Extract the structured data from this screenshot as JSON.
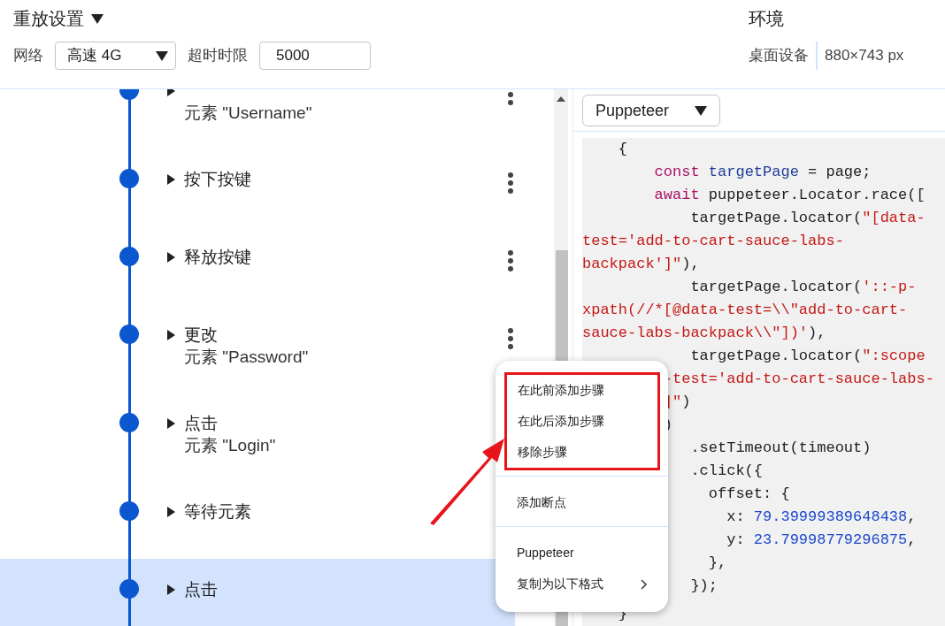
{
  "header": {
    "title": "重放设置",
    "network_label": "网络",
    "network_value": "高速 4G",
    "timeout_label": "超时时限",
    "timeout_value": "5000",
    "environment_title": "环境",
    "device": "桌面设备",
    "viewport": "880×743 px"
  },
  "steps": [
    {
      "subtitle": "元素 \"Username\"",
      "selected": false,
      "more_menu": true
    },
    {
      "title": "按下按键",
      "selected": false,
      "more_menu": true
    },
    {
      "title": "释放按键",
      "selected": false,
      "more_menu": true
    },
    {
      "title": "更改",
      "subtitle": "元素 \"Password\"",
      "selected": false,
      "more_menu": true
    },
    {
      "title": "点击",
      "subtitle": "元素 \"Login\"",
      "selected": false,
      "more_menu": false
    },
    {
      "title": "等待元素",
      "selected": false,
      "more_menu": false
    },
    {
      "title": "点击",
      "selected": true,
      "more_menu": false
    }
  ],
  "code_panel": {
    "format": "Puppeteer",
    "lines": [
      [
        {
          "kind": "plain",
          "text": "    {"
        }
      ],
      [
        {
          "kind": "keyword",
          "text": "        const "
        },
        {
          "kind": "def",
          "text": "targetPage"
        },
        {
          "kind": "plain",
          "text": " = page;"
        }
      ],
      [
        {
          "kind": "keyword",
          "text": "        await"
        },
        {
          "kind": "plain",
          "text": " puppeteer.Locator.race(["
        }
      ],
      [
        {
          "kind": "plain",
          "text": "            targetPage.locator("
        },
        {
          "kind": "string",
          "text": "\"[data-"
        }
      ],
      [
        {
          "kind": "string",
          "text": "test='add-to-cart-sauce-labs-"
        }
      ],
      [
        {
          "kind": "string",
          "text": "backpack']\""
        },
        {
          "kind": "plain",
          "text": "),"
        }
      ],
      [
        {
          "kind": "plain",
          "text": "            targetPage.locator("
        },
        {
          "kind": "string",
          "text": "'::-p-"
        }
      ],
      [
        {
          "kind": "string",
          "text": "xpath(//*[@data-test=\\\\\"add-to-cart-"
        }
      ],
      [
        {
          "kind": "string",
          "text": "sauce-labs-backpack\\\\\"])'"
        },
        {
          "kind": "plain",
          "text": "),"
        }
      ],
      [
        {
          "kind": "plain",
          "text": "            targetPage.locator("
        },
        {
          "kind": "string",
          "text": "\":scope"
        }
      ],
      [
        {
          "kind": "string",
          "text": "         -test='add-to-cart-sauce-labs-"
        }
      ],
      [
        {
          "kind": "string",
          "text": "         ]\""
        },
        {
          "kind": "plain",
          "text": ")"
        }
      ],
      [
        {
          "kind": "plain",
          "text": "         )"
        }
      ],
      [
        {
          "kind": "plain",
          "text": "            .setTimeout(timeout)"
        }
      ],
      [
        {
          "kind": "plain",
          "text": "            .click({"
        }
      ],
      [
        {
          "kind": "plain",
          "text": "              offset: {"
        }
      ],
      [
        {
          "kind": "plain",
          "text": "                x: "
        },
        {
          "kind": "number",
          "text": "79.39999389648438"
        },
        {
          "kind": "plain",
          "text": ","
        }
      ],
      [
        {
          "kind": "plain",
          "text": "                y: "
        },
        {
          "kind": "number",
          "text": "23.79998779296875"
        },
        {
          "kind": "plain",
          "text": ","
        }
      ],
      [
        {
          "kind": "plain",
          "text": "              },"
        }
      ],
      [
        {
          "kind": "plain",
          "text": "            });"
        }
      ],
      [
        {
          "kind": "plain",
          "text": "    }"
        }
      ]
    ]
  },
  "context_menu": {
    "groups": [
      {
        "highlighted": true,
        "items": [
          {
            "label": "在此前添加步骤",
            "submenu": false
          },
          {
            "label": "在此后添加步骤",
            "submenu": false
          },
          {
            "label": "移除步骤",
            "submenu": false
          }
        ]
      },
      {
        "highlighted": false,
        "items": [
          {
            "label": "添加断点",
            "submenu": false
          }
        ]
      },
      {
        "highlighted": false,
        "items": [
          {
            "label": "Puppeteer",
            "submenu": false
          },
          {
            "label": "复制为以下格式",
            "submenu": true
          }
        ]
      }
    ]
  }
}
